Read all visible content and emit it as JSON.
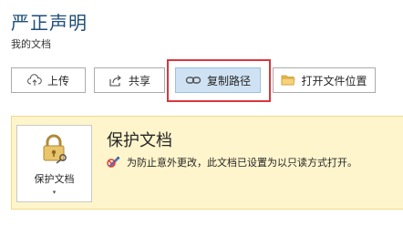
{
  "header": {
    "title": "严正声明",
    "subtitle": "我的文档"
  },
  "toolbar": {
    "upload": {
      "label": "上传",
      "icon": "cloud-upload-icon"
    },
    "share": {
      "label": "共享",
      "icon": "share-icon"
    },
    "copy_path": {
      "label": "复制路径",
      "icon": "link-icon"
    },
    "open_location": {
      "label": "打开文件位置",
      "icon": "folder-icon"
    }
  },
  "protect": {
    "button_label": "保护文档",
    "caret": "▾",
    "title": "保护文档",
    "description": "为防止意外更改，此文档已设置为以只读方式打开。"
  },
  "colors": {
    "title": "#1f4e79",
    "highlight_border": "#d9363e",
    "selected_button": "#cfe2f3",
    "panel_background": "#fff5cc"
  }
}
